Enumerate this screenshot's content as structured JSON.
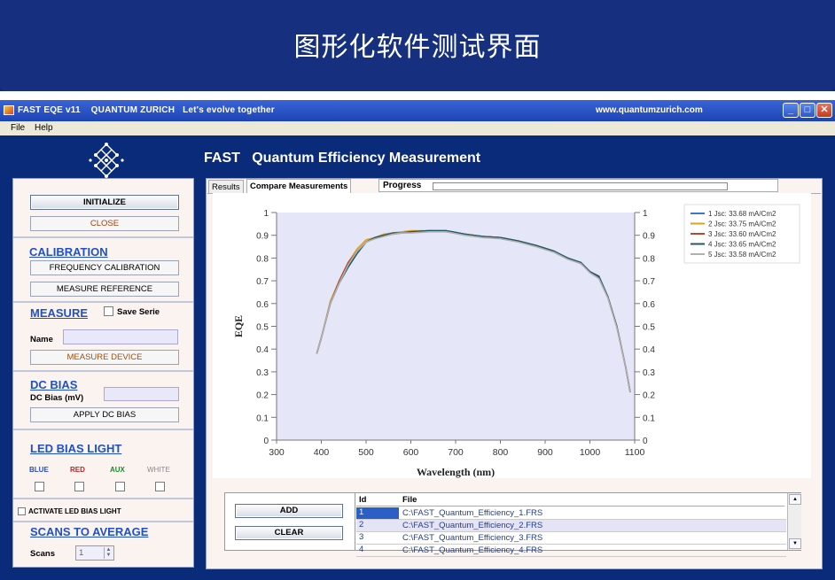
{
  "banner": {
    "title": "图形化软件测试界面"
  },
  "window": {
    "title": "FAST EQE v11    QUANTUM ZURICH   Let's evolve together",
    "url": "www.quantumzurich.com",
    "controls": {
      "minimize": "_",
      "maximize": "□",
      "close": "✕"
    }
  },
  "menu": {
    "items": [
      "File",
      "Help"
    ]
  },
  "app": {
    "heading": "FAST   Quantum Efficiency Measurement"
  },
  "left": {
    "initialize": "INITIALIZE",
    "close": "CLOSE",
    "calibration": {
      "title": "CALIBRATION",
      "frequency": "FREQUENCY CALIBRATION",
      "reference": "MEASURE REFERENCE"
    },
    "measure": {
      "title": "MEASURE",
      "save_serie": "Save Serie",
      "name_label": "Name",
      "name_value": "",
      "device": "MEASURE DEVICE"
    },
    "dc_bias": {
      "title": "DC BIAS",
      "label": "DC Bias (mV)",
      "value": "",
      "apply": "APPLY DC BIAS"
    },
    "led": {
      "title": "LED BIAS LIGHT",
      "colors": [
        {
          "label": "BLUE",
          "color": "#2a4fc0"
        },
        {
          "label": "RED",
          "color": "#c02020"
        },
        {
          "label": "AUX",
          "color": "#1e8a2a"
        },
        {
          "label": "WHITE",
          "color": "#888888"
        }
      ],
      "activate": "ACTIVATE LED BIAS LIGHT"
    },
    "scans": {
      "title": "SCANS TO AVERAGE",
      "label": "Scans",
      "value": "1"
    }
  },
  "right": {
    "tabs": [
      "Results",
      "Compare Measurements"
    ],
    "progress_label": "Progress",
    "progress_value": 0,
    "add": "ADD",
    "clear": "CLEAR",
    "table": {
      "headers": [
        "Id",
        "File"
      ],
      "rows": [
        {
          "id": "1",
          "file": "C:\\FAST_Quantum_Efficiency_1.FRS"
        },
        {
          "id": "2",
          "file": "C:\\FAST_Quantum_Efficiency_2.FRS"
        },
        {
          "id": "3",
          "file": "C:\\FAST_Quantum_Efficiency_3.FRS"
        },
        {
          "id": "4",
          "file": "C:\\FAST_Quantum_Efficiency_4.FRS"
        }
      ]
    }
  },
  "chart_data": {
    "type": "line",
    "title": "",
    "xlabel": "Wavelength (nm)",
    "ylabel": "EQE",
    "xlim": [
      300,
      1100
    ],
    "ylim": [
      0,
      1
    ],
    "xticks": [
      300,
      400,
      500,
      600,
      700,
      800,
      900,
      1000,
      1100
    ],
    "yticks": [
      "0",
      "0.1",
      "0.2",
      "0.3",
      "0.4",
      "0.5",
      "0.6",
      "0.7",
      "0.8",
      "0.9",
      "1"
    ],
    "grid": false,
    "legend_position": "top-right",
    "x": [
      390,
      400,
      420,
      440,
      460,
      480,
      500,
      520,
      540,
      560,
      580,
      600,
      640,
      680,
      720,
      760,
      800,
      840,
      880,
      920,
      950,
      980,
      1000,
      1020,
      1040,
      1060,
      1080,
      1090
    ],
    "series": [
      {
        "name": "1  Jsc: 33.68 mA/Cm2",
        "color": "#3a78c8",
        "values": [
          0.38,
          0.45,
          0.6,
          0.69,
          0.77,
          0.83,
          0.87,
          0.89,
          0.9,
          0.91,
          0.91,
          0.915,
          0.92,
          0.92,
          0.905,
          0.895,
          0.89,
          0.875,
          0.855,
          0.83,
          0.8,
          0.78,
          0.74,
          0.72,
          0.63,
          0.5,
          0.32,
          0.21
        ]
      },
      {
        "name": "2  Jsc: 33.75 mA/Cm2",
        "color": "#e0a020",
        "values": [
          0.38,
          0.45,
          0.61,
          0.7,
          0.78,
          0.84,
          0.88,
          0.89,
          0.905,
          0.91,
          0.915,
          0.92,
          0.92,
          0.915,
          0.905,
          0.895,
          0.89,
          0.875,
          0.855,
          0.83,
          0.8,
          0.775,
          0.74,
          0.715,
          0.63,
          0.5,
          0.32,
          0.21
        ]
      },
      {
        "name": "3  Jsc: 33.60 mA/Cm2",
        "color": "#b84a2a",
        "values": [
          0.38,
          0.45,
          0.6,
          0.7,
          0.78,
          0.83,
          0.87,
          0.89,
          0.9,
          0.905,
          0.91,
          0.915,
          0.92,
          0.915,
          0.905,
          0.895,
          0.89,
          0.875,
          0.855,
          0.83,
          0.8,
          0.775,
          0.74,
          0.715,
          0.63,
          0.5,
          0.32,
          0.21
        ]
      },
      {
        "name": "4  Jsc: 33.65 mA/Cm2",
        "color": "#1f5a6a",
        "values": [
          0.38,
          0.45,
          0.6,
          0.69,
          0.76,
          0.82,
          0.87,
          0.89,
          0.9,
          0.91,
          0.91,
          0.915,
          0.92,
          0.92,
          0.905,
          0.895,
          0.89,
          0.875,
          0.855,
          0.83,
          0.8,
          0.78,
          0.74,
          0.72,
          0.63,
          0.5,
          0.32,
          0.21
        ]
      },
      {
        "name": "5  Jsc: 33.58 mA/Cm2",
        "color": "#b0b0b0",
        "values": [
          0.38,
          0.45,
          0.6,
          0.69,
          0.77,
          0.83,
          0.87,
          0.885,
          0.895,
          0.905,
          0.91,
          0.91,
          0.915,
          0.915,
          0.9,
          0.89,
          0.885,
          0.87,
          0.85,
          0.825,
          0.795,
          0.775,
          0.735,
          0.71,
          0.625,
          0.495,
          0.32,
          0.21
        ]
      }
    ]
  }
}
